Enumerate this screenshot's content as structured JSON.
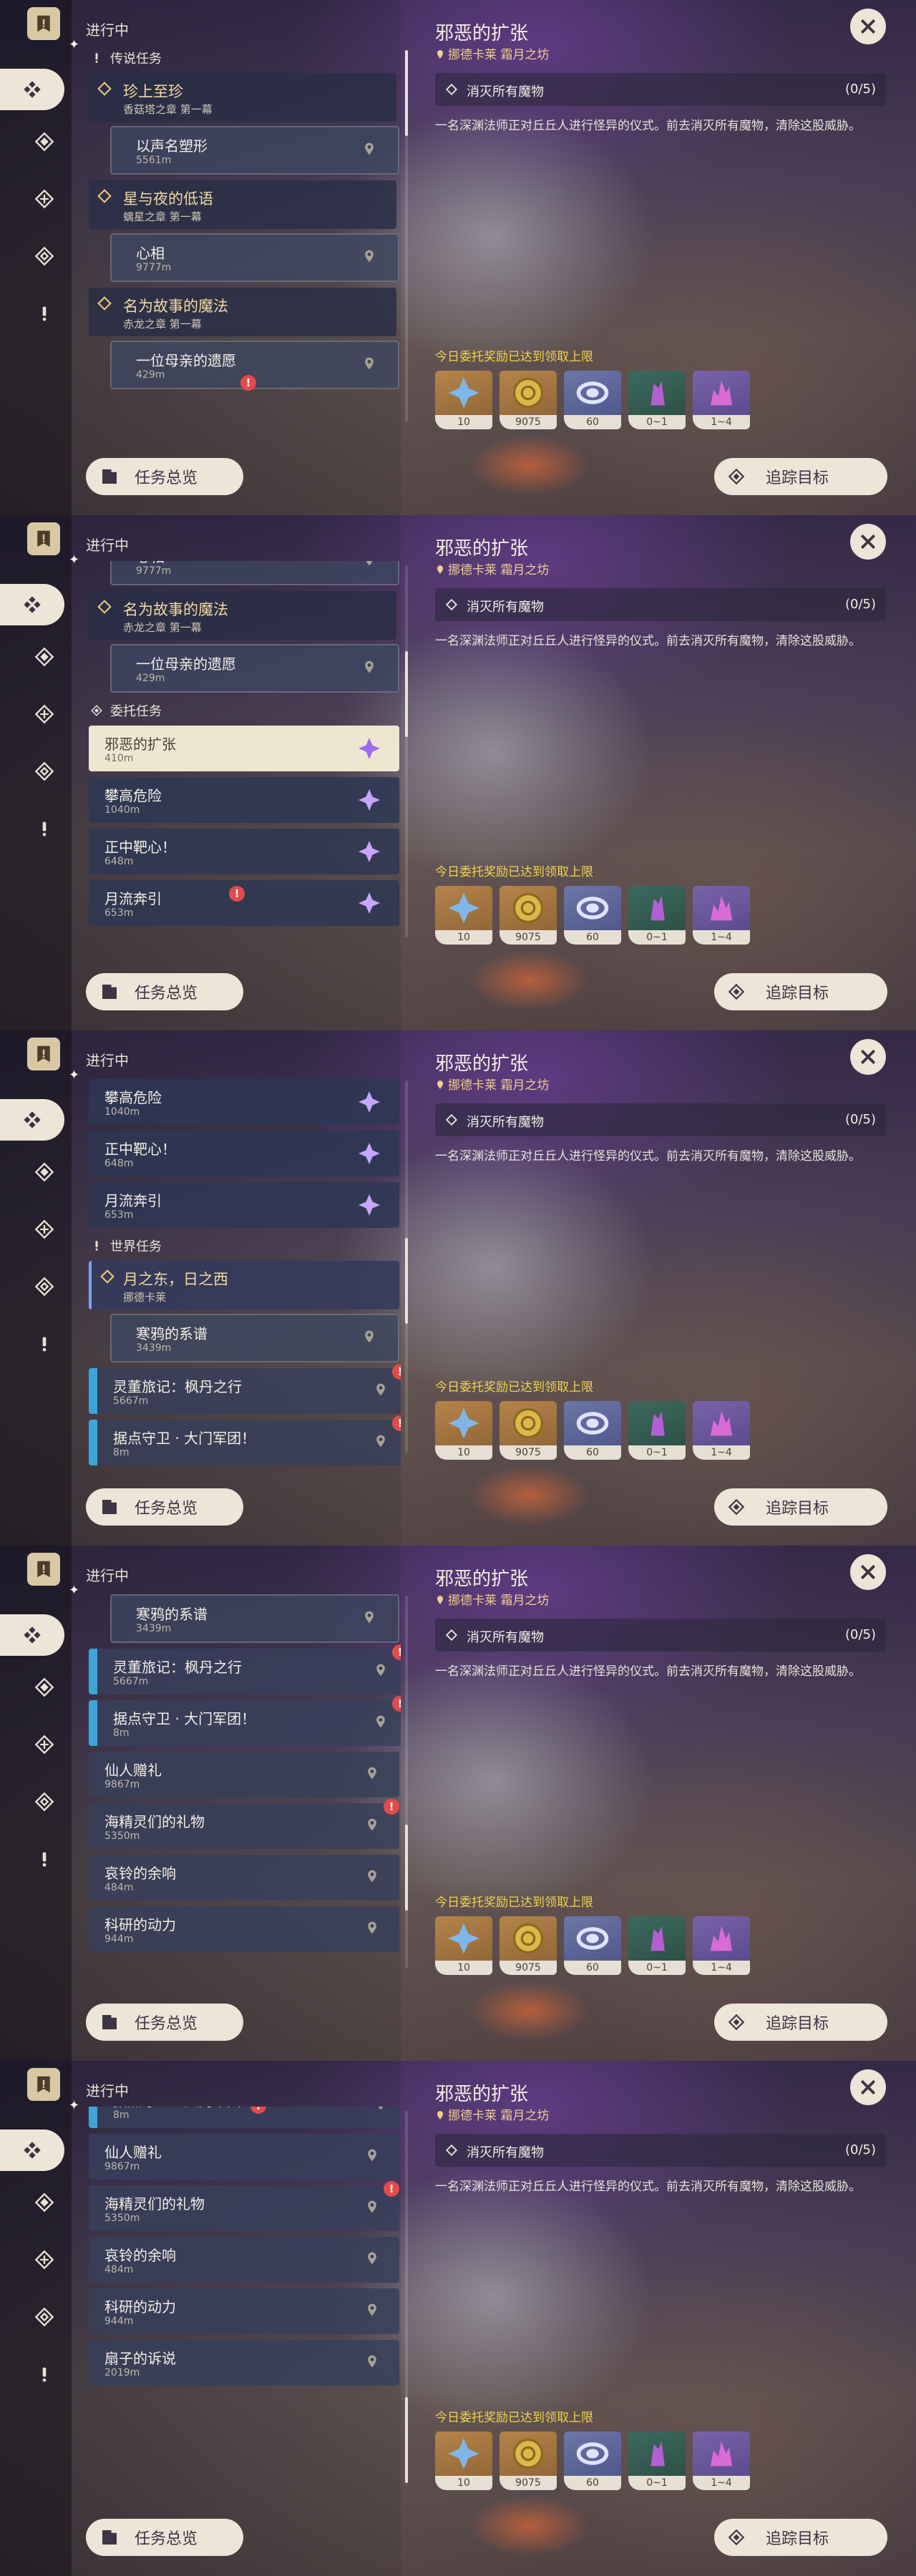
{
  "common": {
    "section_in_progress": "进行中",
    "overview_button": "任务总览",
    "track_button": "追踪目标",
    "detail": {
      "title": "邪恶的扩张",
      "location": "挪德卡莱 霜月之坊",
      "objective": "消灭所有魔物",
      "progress": "(0/5)",
      "description": "一名深渊法师正对丘丘人进行怪异的仪式。前去消灭所有魔物，清除这股威胁。",
      "reward_note": "今日委托奖励已达到领取上限",
      "rewards": [
        {
          "icon": "adventure-exp-icon",
          "count": "10"
        },
        {
          "icon": "mora-coin-icon",
          "count": "9075"
        },
        {
          "icon": "companionship-exp-icon",
          "count": "60"
        },
        {
          "icon": "green-crystal-icon",
          "count": "0~1"
        },
        {
          "icon": "pink-crystal-icon",
          "count": "1~4"
        }
      ]
    },
    "colors": {
      "accent_gold": "#f0cf90",
      "reward_note": "#f1d34a",
      "commission_purple": "#c7a6ff",
      "world_quest_blue": "#3aa6d9",
      "alert_red": "#e34a4a"
    }
  },
  "legend_group": {
    "label": "传说任务",
    "quests": [
      {
        "name": "珍上至珍",
        "chapter": "香菇塔之章 第一幕",
        "subtask": "以声名塑形",
        "distance": "5561m"
      },
      {
        "name": "星与夜的低语",
        "chapter": "螭星之章 第一幕",
        "subtask": "心相",
        "distance": "9777m"
      },
      {
        "name": "名为故事的魔法",
        "chapter": "赤龙之章 第一幕",
        "subtask": "一位母亲的遗愿",
        "distance": "429m"
      }
    ]
  },
  "commission_group": {
    "label": "委托任务",
    "items": [
      {
        "name": "邪恶的扩张",
        "distance": "410m"
      },
      {
        "name": "攀高危险",
        "distance": "1040m"
      },
      {
        "name": "正中靶心！",
        "distance": "648m"
      },
      {
        "name": "月流奔引",
        "distance": "653m"
      }
    ]
  },
  "world_group": {
    "label": "世界任务",
    "head_quest": {
      "name": "月之东，日之西",
      "region": "挪德卡莱",
      "subtask": "寒鸦的系谱",
      "distance": "3439m"
    },
    "items": [
      {
        "name": "灵董旅记：枫丹之行",
        "distance": "5667m"
      },
      {
        "name": "据点守卫 · 大门军团！",
        "distance": "8m"
      },
      {
        "name": "仙人赠礼",
        "distance": "9867m"
      },
      {
        "name": "海精灵们的礼物",
        "distance": "5350m"
      },
      {
        "name": "哀铃的余响",
        "distance": "484m"
      },
      {
        "name": "科研的动力",
        "distance": "944m"
      },
      {
        "name": "扇子的诉说",
        "distance": "2019m"
      }
    ]
  },
  "partial_text": {
    "p2_top_dist": "9777m",
    "p2_top_name": "心相"
  }
}
